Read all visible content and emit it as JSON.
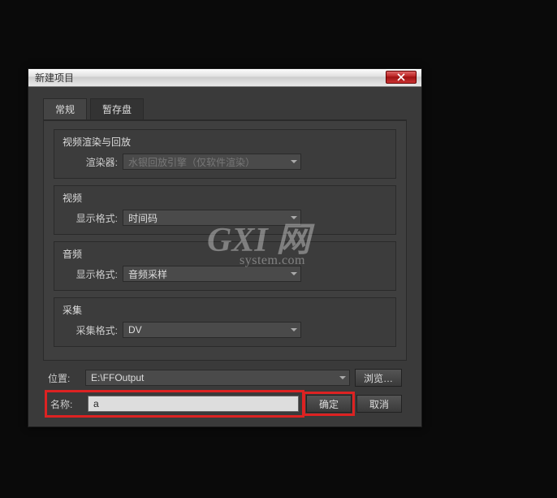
{
  "dialog": {
    "title": "新建项目",
    "tabs": {
      "general": "常规",
      "scratch": "暂存盘"
    },
    "groups": {
      "render": {
        "title": "视频渲染与回放",
        "renderer_label": "渲染器:",
        "renderer_value": "水银回放引擎（仅软件渲染）"
      },
      "video": {
        "title": "视频",
        "format_label": "显示格式:",
        "format_value": "时间码"
      },
      "audio": {
        "title": "音频",
        "format_label": "显示格式:",
        "format_value": "音频采样"
      },
      "capture": {
        "title": "采集",
        "format_label": "采集格式:",
        "format_value": "DV"
      }
    },
    "location": {
      "label": "位置:",
      "value": "E:\\FFOutput",
      "browse": "浏览…"
    },
    "name": {
      "label": "名称:",
      "value": "a"
    },
    "buttons": {
      "ok": "确定",
      "cancel": "取消"
    }
  },
  "watermark": {
    "main": "GXI 网",
    "sub": "system.com"
  }
}
